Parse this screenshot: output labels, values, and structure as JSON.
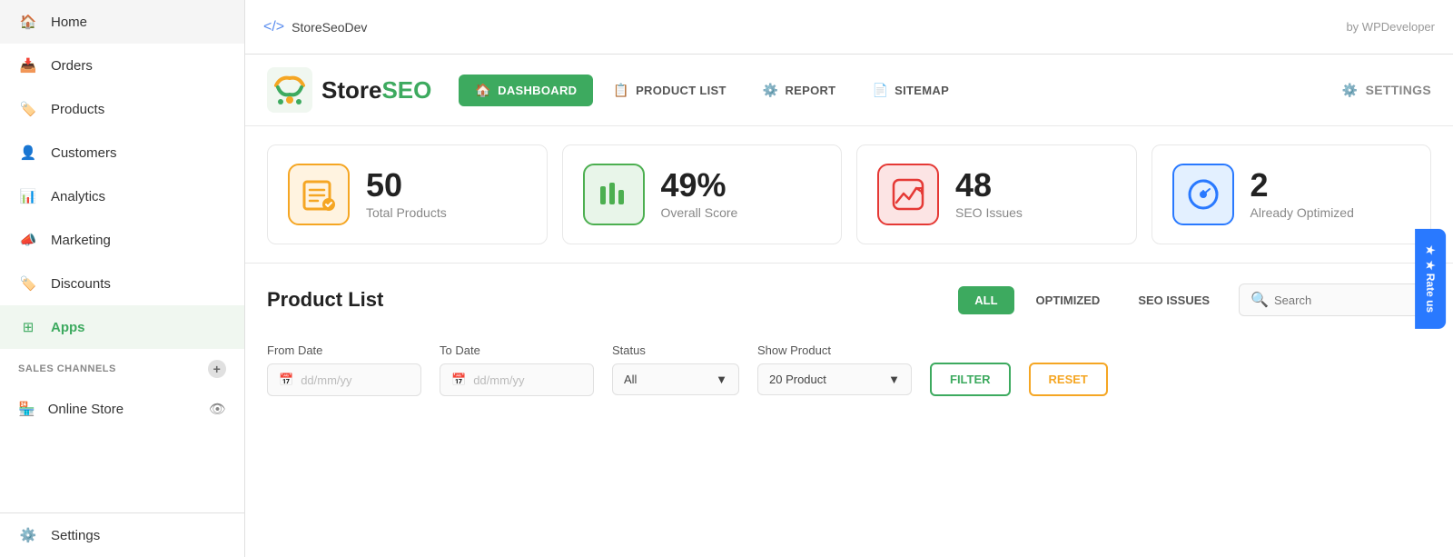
{
  "topbar": {
    "app_name": "StoreSeoDev",
    "by_label": "by WPDeveloper",
    "code_icon": "</>"
  },
  "sidebar": {
    "items": [
      {
        "label": "Home",
        "icon": "🏠",
        "active": false
      },
      {
        "label": "Orders",
        "icon": "📥",
        "active": false
      },
      {
        "label": "Products",
        "icon": "🏷️",
        "active": false
      },
      {
        "label": "Customers",
        "icon": "👤",
        "active": false
      },
      {
        "label": "Analytics",
        "icon": "📊",
        "active": false
      },
      {
        "label": "Marketing",
        "icon": "📣",
        "active": false
      },
      {
        "label": "Discounts",
        "icon": "🏷️",
        "active": false
      },
      {
        "label": "Apps",
        "icon": "⊞",
        "active": true
      }
    ],
    "sales_channels_label": "SALES CHANNELS",
    "online_store_label": "Online Store",
    "settings_label": "Settings"
  },
  "plugin": {
    "logo_text_plain": "Store",
    "logo_text_colored": "SEO",
    "nav_tabs": [
      {
        "label": "DASHBOARD",
        "icon": "🏠",
        "active": true
      },
      {
        "label": "PRODUCT LIST",
        "icon": "📋",
        "active": false
      },
      {
        "label": "REPORT",
        "icon": "⚙️",
        "active": false
      },
      {
        "label": "SITEMAP",
        "icon": "📄",
        "active": false
      }
    ],
    "settings_label": "SETTINGS"
  },
  "stats": [
    {
      "number": "50",
      "label": "Total Products",
      "color_class": "orange"
    },
    {
      "number": "49%",
      "label": "Overall Score",
      "color_class": "green"
    },
    {
      "number": "48",
      "label": "SEO Issues",
      "color_class": "red"
    },
    {
      "number": "2",
      "label": "Already Optimized",
      "color_class": "blue"
    }
  ],
  "product_list": {
    "title": "Product List",
    "filter_tabs": [
      {
        "label": "ALL",
        "active": true
      },
      {
        "label": "OPTIMIZED",
        "active": false
      },
      {
        "label": "SEO ISSUES",
        "active": false
      }
    ],
    "search_placeholder": "Search",
    "from_date_label": "From Date",
    "from_date_placeholder": "dd/mm/yy",
    "to_date_label": "To Date",
    "to_date_placeholder": "dd/mm/yy",
    "status_label": "Status",
    "status_value": "All",
    "show_product_label": "Show Product",
    "show_product_value": "20 Product",
    "filter_btn": "FILTER",
    "reset_btn": "RESET"
  },
  "rate_us": {
    "label": "★  Rate us",
    "icon": "★"
  }
}
